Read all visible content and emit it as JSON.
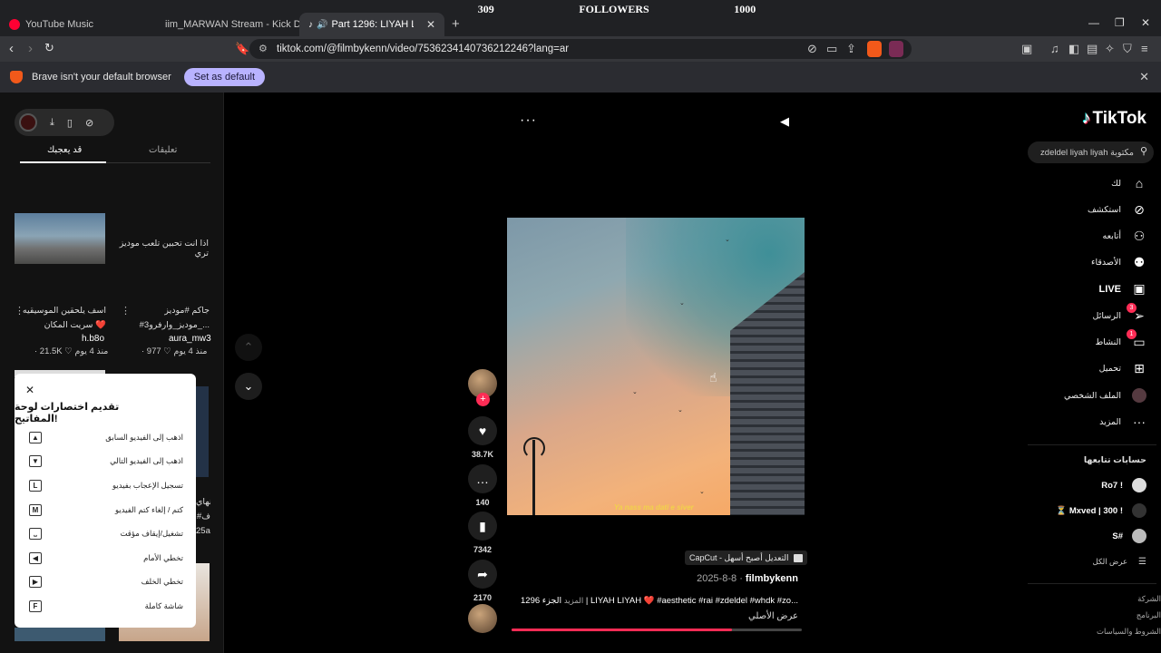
{
  "overlay": {
    "left_count": "309",
    "label": "FOLLOWERS",
    "right_count": "1000"
  },
  "tabs": [
    {
      "title": "YouTube Music",
      "color": "#ff0033"
    },
    {
      "title": "iim_MARWAN Stream - Kick Dashboard",
      "color": "#53fc18"
    },
    {
      "title": "Part 1296: LIYAH LIYAH - Aest",
      "color": "#ffffff"
    }
  ],
  "browser": {
    "url": "tiktok.com/@filmbykenn/video/7536234140736212246?lang=ar",
    "infobar_message": "Brave isn't your default browser",
    "set_default_label": "Set as default"
  },
  "left_panel": {
    "tab_active": "قد يعجبك",
    "tab_other": "تعليقات",
    "video1_caption": "اذا انت تحبين تلعب موديز تري",
    "items": [
      {
        "title_line1": "جاكم #موديز",
        "title_line2": "#موديز_وارفرو3_...",
        "user": "aura_mw3",
        "meta": "· 977 ♡ منذ 4 يوم"
      },
      {
        "title_line1": "اسف يلحقين الموسيقيه",
        "title_line2": "سريت المكان ❤️",
        "user": "h.b8o",
        "meta": "· 21.5K ♡ منذ 4 يوم"
      }
    ],
    "peek_text": [
      "النهاي",
      "#ف",
      "25al"
    ]
  },
  "shortcuts": {
    "title": "تقديم اختصارات لوحة المفاتيح!",
    "rows": [
      {
        "key": "▲",
        "label": "اذهب إلى الفيديو السابق"
      },
      {
        "key": "▼",
        "label": "اذهب إلى الفيديو التالي"
      },
      {
        "key": "L",
        "label": "تسجيل الإعجاب بفيديو"
      },
      {
        "key": "M",
        "label": "كتم / إلغاء كتم الفيديو"
      },
      {
        "key": "⎵",
        "label": "تشغيل/إيقاف مؤقت"
      },
      {
        "key": "◀",
        "label": "تخطي الأمام"
      },
      {
        "key": "▶",
        "label": "تخطي الخلف"
      },
      {
        "key": "F",
        "label": "شاشة كاملة"
      }
    ]
  },
  "video": {
    "caption_overlay": "Ya nass ma dati e siver",
    "likes": "38.7K",
    "comments": "140",
    "saves": "7342",
    "shares": "2170",
    "capcut_label": "CapCut - التعديل أصبح أسهل",
    "author": "filmbykenn",
    "date": "2025-8-8",
    "description": "الجزء 1296 | LIYAH LIYAH ❤️ #aesthetic #rai #zdeldel #whdk #zo...",
    "more_label": "المزيد",
    "sound": "عرض الأصلي",
    "progress": 0.76
  },
  "right_panel": {
    "logo_text": "TikTok",
    "search_placeholder": "zdeldel liyah liyah مكتوبة",
    "nav": [
      {
        "label": "لك",
        "icon": "home-icon",
        "glyph": "⌂"
      },
      {
        "label": "استكشف",
        "icon": "compass-icon",
        "glyph": "⊘"
      },
      {
        "label": "أتابعه",
        "icon": "following-icon",
        "glyph": "⚇"
      },
      {
        "label": "الأصدقاء",
        "icon": "friends-icon",
        "glyph": "⚉"
      },
      {
        "label": "LIVE",
        "icon": "live-icon",
        "glyph": "▣"
      },
      {
        "label": "الرسائل",
        "icon": "messages-icon",
        "glyph": "➢",
        "badge": "3"
      },
      {
        "label": "النشاط",
        "icon": "activity-icon",
        "glyph": "▭",
        "badge": "1"
      },
      {
        "label": "تحميل",
        "icon": "upload-icon",
        "glyph": "⊞"
      },
      {
        "label": "الملف الشخصي",
        "icon": "profile-icon",
        "glyph": ""
      },
      {
        "label": "المزيد",
        "icon": "more-icon",
        "glyph": "···"
      }
    ],
    "following_heading": "حسابات تتابعها",
    "following": [
      {
        "name": "Ro7 !"
      },
      {
        "name": "⏳ Mxved | 300 !"
      },
      {
        "name": "S#"
      }
    ],
    "see_all": "عرض الكل",
    "footer": [
      "الشركة",
      "البرنامج",
      "الشروط والسياسات"
    ]
  }
}
